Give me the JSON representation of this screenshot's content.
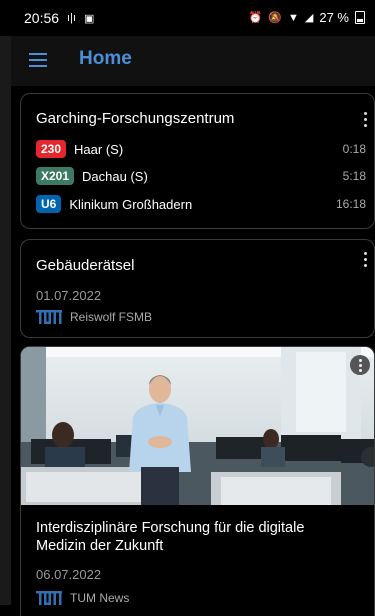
{
  "status_bar": {
    "time": "20:56",
    "battery": "27 %"
  },
  "app_bar": {
    "title": "Home"
  },
  "transit_card": {
    "station": "Garching-Forschungszentrum",
    "departures": [
      {
        "line": "230",
        "color": "#e3272d",
        "destination": "Haar (S)",
        "time": "0:18"
      },
      {
        "line": "X201",
        "color": "#3d7a63",
        "destination": "Dachau (S)",
        "time": "5:18"
      },
      {
        "line": "U6",
        "color": "#0065ae",
        "destination": "Klinikum Großhadern",
        "time": "16:18"
      }
    ]
  },
  "news_cards": [
    {
      "title": "Gebäuderätsel",
      "date": "01.07.2022",
      "source": "Reiswolf FSMB"
    },
    {
      "title": "Interdisziplinäre Forschung für die digitale Medizin der Zukunft",
      "date": "06.07.2022",
      "source": "TUM News"
    }
  ]
}
